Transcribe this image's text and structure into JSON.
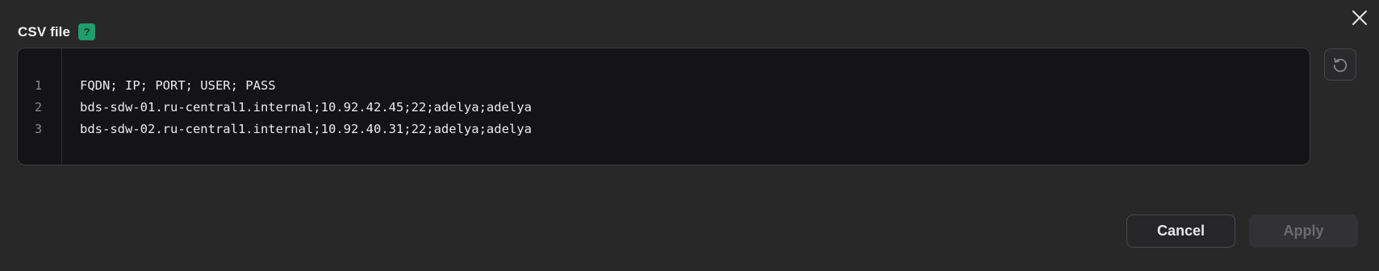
{
  "dialog": {
    "field_label": "CSV file",
    "help_badge": "?"
  },
  "editor": {
    "lines": [
      {
        "number": "1",
        "text": "FQDN; IP; PORT; USER; PASS"
      },
      {
        "number": "2",
        "text": "bds-sdw-01.ru-central1.internal;10.92.42.45;22;adelya;adelya"
      },
      {
        "number": "3",
        "text": "bds-sdw-02.ru-central1.internal;10.92.40.31;22;adelya;adelya"
      }
    ]
  },
  "actions": {
    "cancel_label": "Cancel",
    "apply_label": "Apply",
    "apply_disabled": true
  },
  "icons": {
    "close": "close-icon",
    "reset": "reset-icon"
  },
  "colors": {
    "background": "#282828",
    "editor_background": "#141316",
    "help_badge": "#1e9e6a"
  }
}
